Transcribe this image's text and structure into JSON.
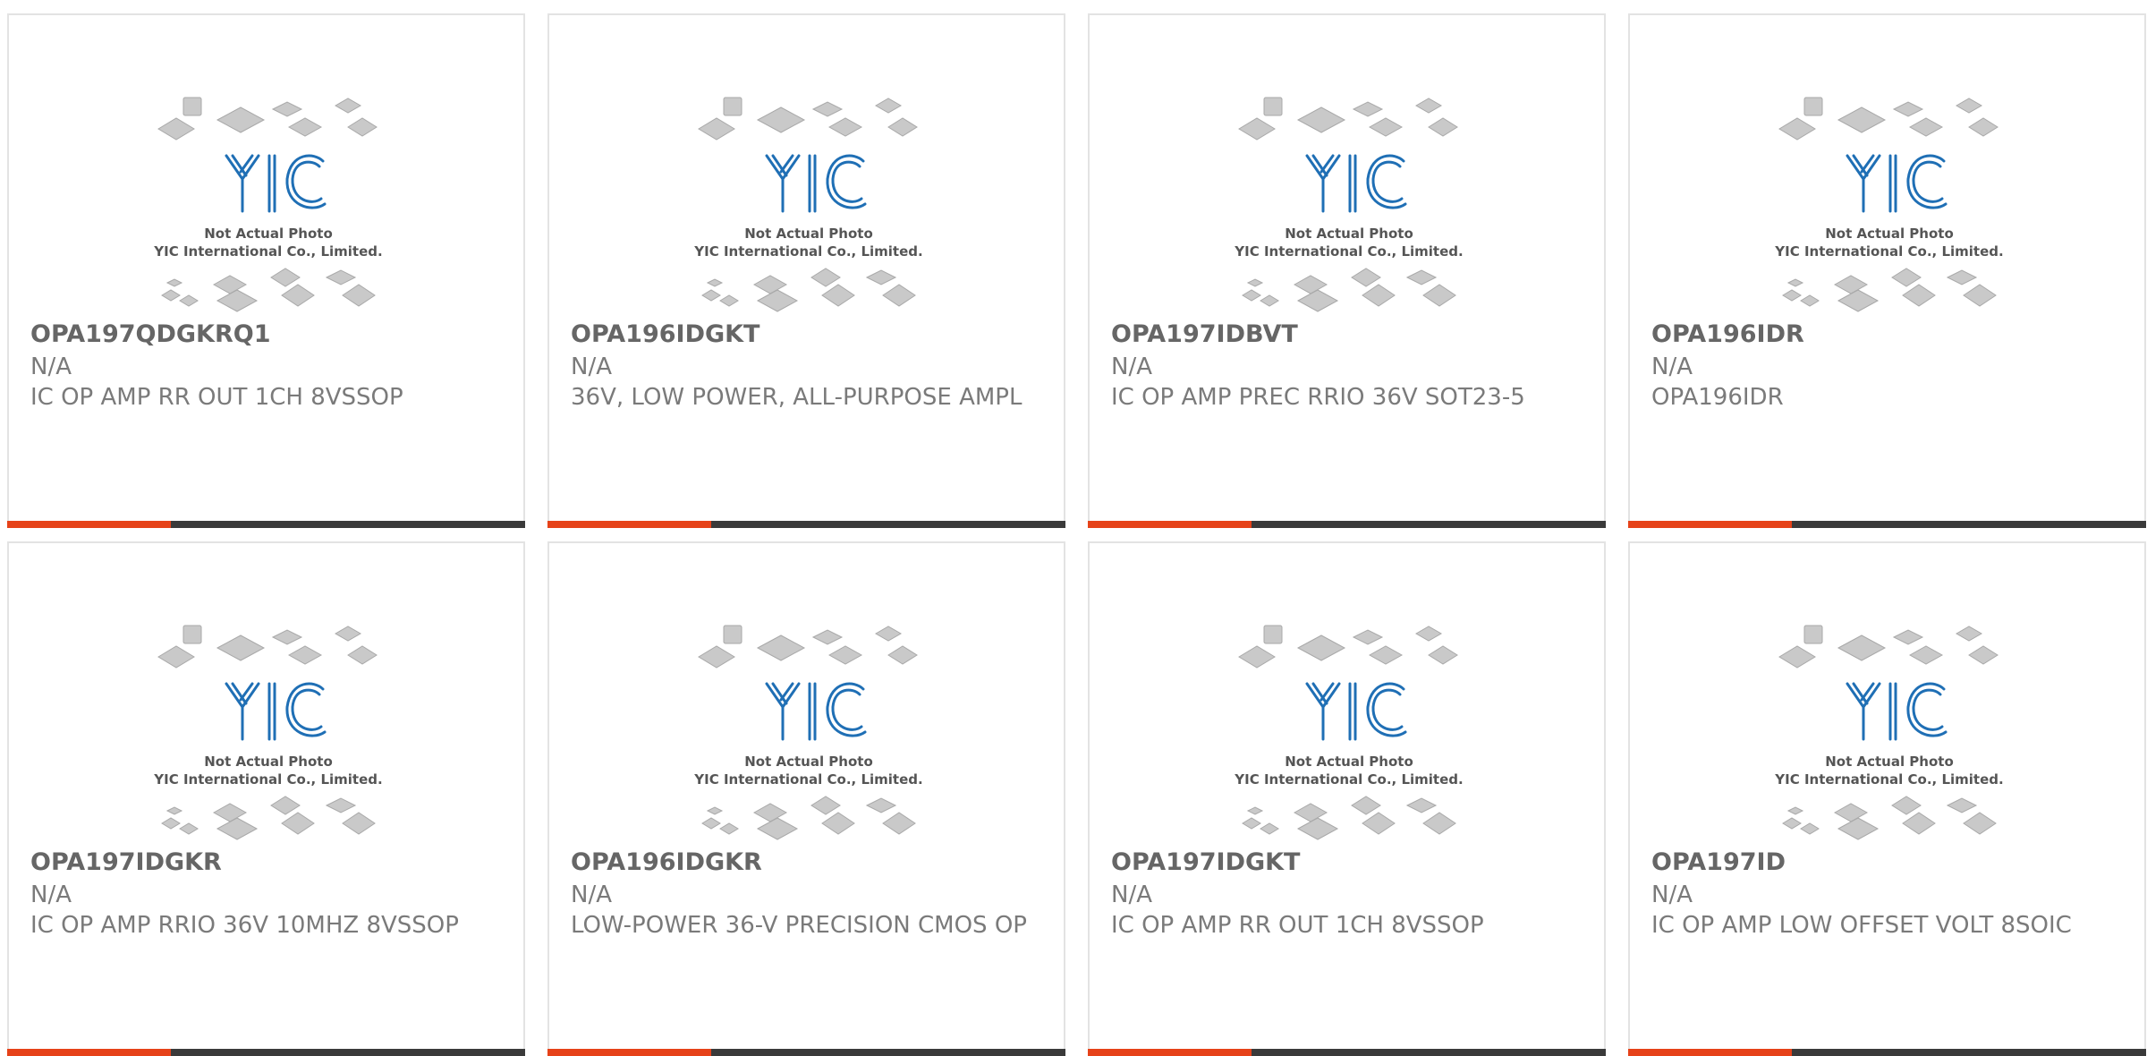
{
  "placeholder_image": {
    "caption_line1": "Not Actual Photo",
    "caption_line2": "YIC International Co., Limited.",
    "logo_text": "YIC"
  },
  "colors": {
    "accent": "#e64219",
    "bar_dark": "#3a3a3a",
    "logo_blue": "#1f6fb5",
    "text_gray": "#7a7a7a"
  },
  "products": [
    {
      "part_number": "OPA197QDGKRQ1",
      "manufacturer": "N/A",
      "description": "IC OP AMP RR OUT 1CH 8VSSOP"
    },
    {
      "part_number": "OPA196IDGKT",
      "manufacturer": "N/A",
      "description": "36V, LOW POWER, ALL-PURPOSE AMPL"
    },
    {
      "part_number": "OPA197IDBVT",
      "manufacturer": "N/A",
      "description": "IC OP AMP PREC RRIO 36V SOT23-5"
    },
    {
      "part_number": "OPA196IDR",
      "manufacturer": "N/A",
      "description": "OPA196IDR"
    },
    {
      "part_number": "OPA197IDGKR",
      "manufacturer": "N/A",
      "description": "IC OP AMP RRIO 36V 10MHZ 8VSSOP"
    },
    {
      "part_number": "OPA196IDGKR",
      "manufacturer": "N/A",
      "description": "LOW-POWER 36-V PRECISION CMOS OP"
    },
    {
      "part_number": "OPA197IDGKT",
      "manufacturer": "N/A",
      "description": "IC OP AMP RR OUT 1CH 8VSSOP"
    },
    {
      "part_number": "OPA197ID",
      "manufacturer": "N/A",
      "description": "IC OP AMP LOW OFFSET VOLT 8SOIC"
    }
  ]
}
